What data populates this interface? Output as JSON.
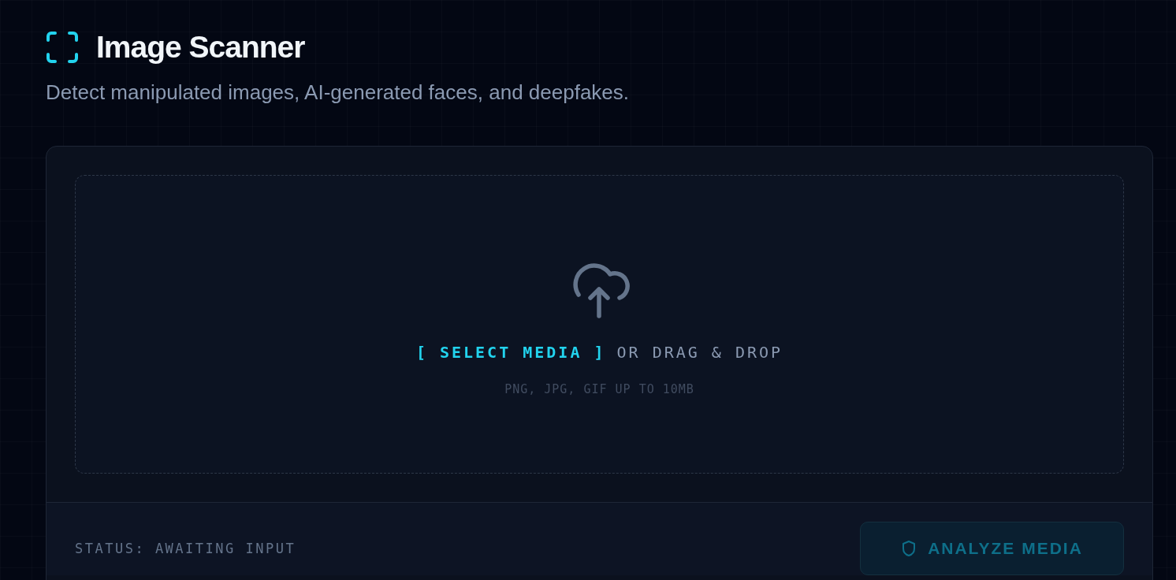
{
  "header": {
    "title": "Image Scanner",
    "subtitle": "Detect manipulated images, AI-generated faces, and deepfakes."
  },
  "dropzone": {
    "select_label": "[ SELECT MEDIA ]",
    "drag_label": "OR DRAG & DROP",
    "hint": "PNG, JPG, GIF UP TO 10MB"
  },
  "footer": {
    "status": "STATUS: AWAITING INPUT",
    "analyze_button": {
      "label": "ANALYZE MEDIA",
      "disabled": true
    }
  }
}
